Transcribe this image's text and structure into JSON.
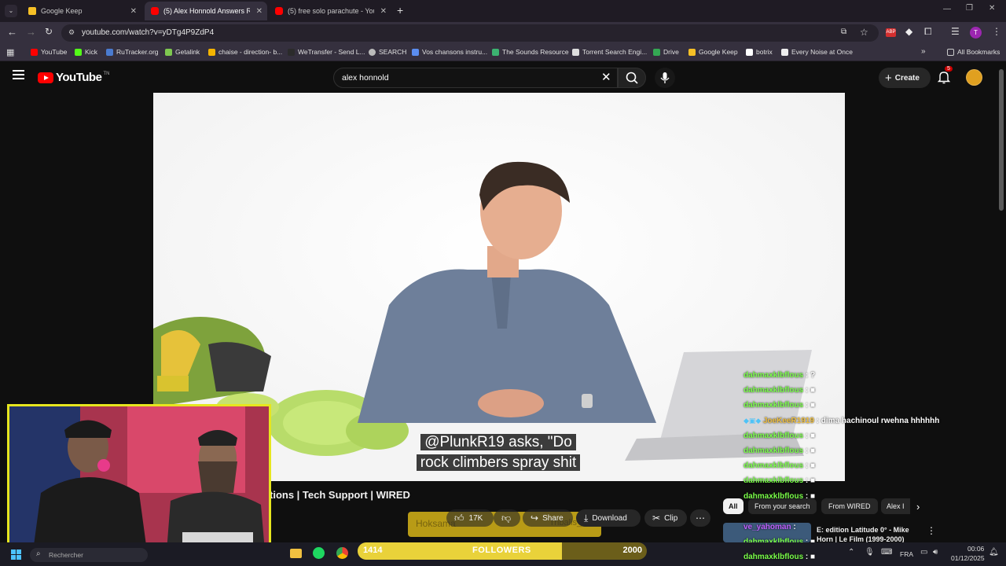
{
  "browser": {
    "tabs": [
      {
        "title": "Google Keep",
        "favicon": "keep-icon",
        "color": "#f6c026",
        "active": false
      },
      {
        "title": "(5) Alex Honnold Answers Rock",
        "favicon": "youtube-icon",
        "color": "#ff0000",
        "active": true
      },
      {
        "title": "(5) free solo parachute - YouTu",
        "favicon": "youtube-icon",
        "color": "#ff0000",
        "active": false
      }
    ],
    "url": "youtube.com/watch?v=yDTg4P9ZdP4",
    "bookmarks": [
      {
        "label": "YouTube",
        "color": "#ff0000"
      },
      {
        "label": "Kick",
        "color": "#53fc18"
      },
      {
        "label": "RuTracker.org",
        "color": "#4a7bd0"
      },
      {
        "label": "Getalink",
        "color": "#7ec850"
      },
      {
        "label": "chaise - direction- b...",
        "color": "#f4b400"
      },
      {
        "label": "WeTransfer - Send L...",
        "color": "#2b2b2b"
      },
      {
        "label": "SEARCH",
        "color": "#bbbbbb"
      },
      {
        "label": "Vos chansons instru...",
        "color": "#5b8def"
      },
      {
        "label": "The Sounds Resource",
        "color": "#3cb371"
      },
      {
        "label": "Torrent Search Engi...",
        "color": "#dddddd"
      },
      {
        "label": "Drive",
        "color": "#34a853"
      },
      {
        "label": "Google Keep",
        "color": "#f6c026"
      },
      {
        "label": "botrix",
        "color": "#ffffff"
      },
      {
        "label": "Every Noise at Once",
        "color": "#eeeeee"
      }
    ],
    "all_bookmarks": "All Bookmarks",
    "profile_initial": "T"
  },
  "youtube": {
    "logo_text": "YouTube",
    "logo_sup": "TN",
    "search_value": "alex honnold",
    "create_label": "Create",
    "notification_count": "5",
    "caption_line1": "@PlunkR19 asks, \"Do",
    "caption_line2": "rock climbers spray shit",
    "video_title_visible": "tions | Tech Support | WIRED",
    "like_count": "17K",
    "share_label": "Share",
    "download_label": "Download",
    "clip_label": "Clip",
    "ghost_left": "Hoksama",
    "ghost_right": "Tribalis_b",
    "chips": [
      "All",
      "From your search",
      "From WIRED",
      "Alex I"
    ],
    "rec_title_line1": "E: edition Latitude 0° - Mike",
    "rec_title_line2": "Horn | Le Film (1999-2000)"
  },
  "chat": [
    {
      "user": "dahmaxklbflous",
      "msg": "?"
    },
    {
      "user": "dahmaxklbflous",
      "msg": "■"
    },
    {
      "user": "dahmaxklbflous",
      "msg": "■"
    },
    {
      "user": "JoeKeeR1919",
      "msg": "dima hachinoul rwehna hhhhhh",
      "user_color": "#f0c040"
    },
    {
      "user": "dahmaxklbflous",
      "msg": "■"
    },
    {
      "user": "dahmaxklbflous",
      "msg": "■"
    },
    {
      "user": "dahmaxklbflous",
      "msg": "■"
    },
    {
      "user": "dahmaxklbflous",
      "msg": "■"
    },
    {
      "user": "dahmaxklbflous",
      "msg": "■"
    },
    {
      "user": "ve_yahoman",
      "msg": "",
      "user_color": "#c060ff"
    },
    {
      "user": "dahmaxklbflous",
      "msg": "■"
    },
    {
      "user": "dahmaxklbflous",
      "msg": "■"
    }
  ],
  "followers": {
    "current": "1414",
    "label": "FOLLOWERS",
    "goal": "2000",
    "progress": 0.707
  },
  "taskbar": {
    "search_placeholder": "Rechercher",
    "lang": "FRA",
    "time": "00:06",
    "date": "01/12/2025"
  }
}
